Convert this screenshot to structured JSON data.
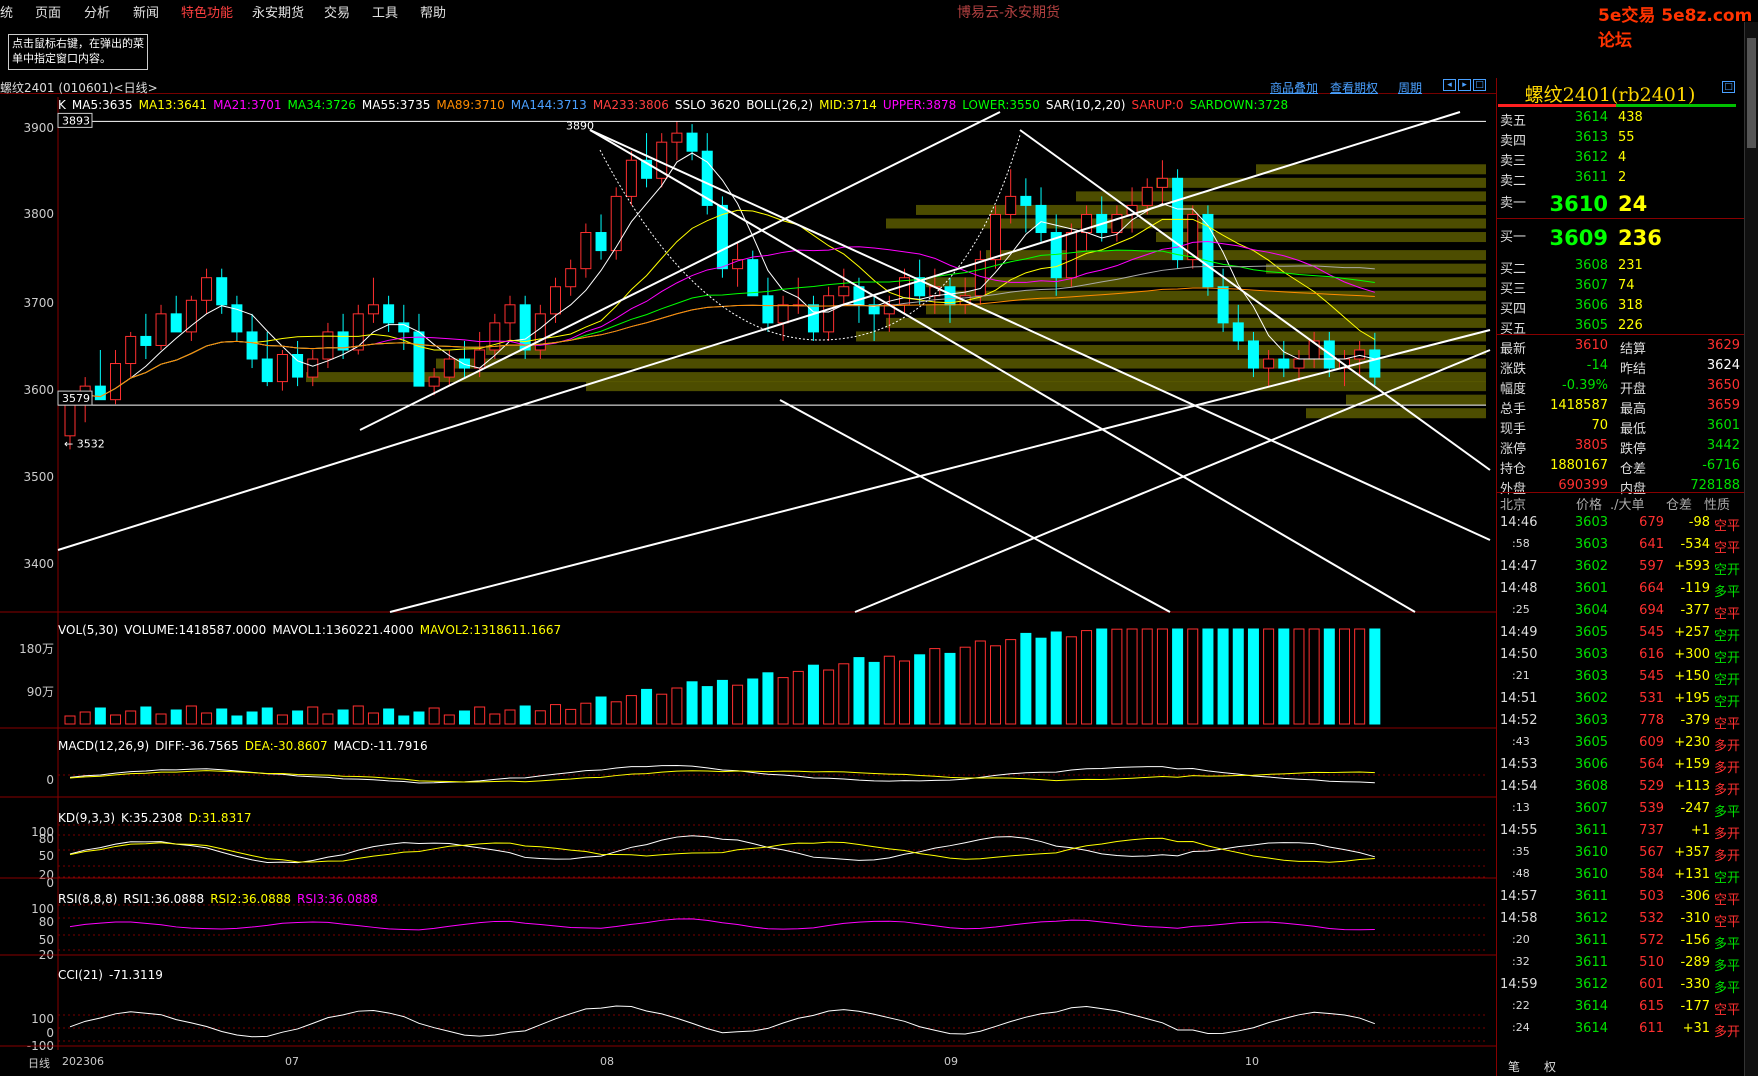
{
  "menu": [
    "统",
    "页面",
    "分析",
    "新闻",
    "特色功能",
    "永安期货",
    "交易",
    "工具",
    "帮助"
  ],
  "app_title": "博易云-永安期货",
  "watermark": "5e交易 5e8z.com 论坛",
  "tip": "点击鼠标右键，在弹出的菜单中指定窗口内容。",
  "symbol_label": "螺纹2401 (010601)<日线>",
  "header_links": [
    "商品叠加",
    "查看期权",
    "周期"
  ],
  "main_legend": [
    {
      "text": "K",
      "color": "#ffffff"
    },
    {
      "text": "MA5:3635",
      "color": "#ffffff"
    },
    {
      "text": "MA13:3641",
      "color": "#ffff00"
    },
    {
      "text": "MA21:3701",
      "color": "#ff00ff"
    },
    {
      "text": "MA34:3726",
      "color": "#00ff00"
    },
    {
      "text": "MA55:3735",
      "color": "#ffffff"
    },
    {
      "text": "MA89:3710",
      "color": "#ff8c00"
    },
    {
      "text": "MA144:3713",
      "color": "#4aa0ff"
    },
    {
      "text": "MA233:3806",
      "color": "#ff4040"
    },
    {
      "text": "SSLO 3620",
      "color": "#ffffff"
    },
    {
      "text": "BOLL(26,2)",
      "color": "#ffffff"
    },
    {
      "text": "MID:3714",
      "color": "#ffff00"
    },
    {
      "text": "UPPER:3878",
      "color": "#ff00ff"
    },
    {
      "text": "LOWER:3550",
      "color": "#00ff00"
    },
    {
      "text": "SAR(10,2,20)",
      "color": "#ffffff"
    },
    {
      "text": "SARUP:0",
      "color": "#ff3030"
    },
    {
      "text": "SARDOWN:3728",
      "color": "#00ff00"
    }
  ],
  "price_axis": [
    "3900",
    "3800",
    "3700",
    "3600",
    "3500",
    "3400"
  ],
  "price_marks": {
    "high_box": "3893",
    "low_box": "3579",
    "peak": "3890",
    "low": "3532"
  },
  "vol_legend": [
    {
      "text": "VOL(5,30)",
      "color": "#ffffff"
    },
    {
      "text": "VOLUME:1418587.0000",
      "color": "#ffffff"
    },
    {
      "text": "MAVOL1:1360221.4000",
      "color": "#ffffff"
    },
    {
      "text": "MAVOL2:1318611.1667",
      "color": "#ffff00"
    }
  ],
  "vol_axis": [
    "180万",
    "90万"
  ],
  "macd_legend": [
    {
      "text": "MACD(12,26,9)",
      "color": "#ffffff"
    },
    {
      "text": "DIFF:-36.7565",
      "color": "#ffffff"
    },
    {
      "text": "DEA:-30.8607",
      "color": "#ffff00"
    },
    {
      "text": "MACD:-11.7916",
      "color": "#ffffff"
    }
  ],
  "macd_axis": [
    "0"
  ],
  "kd_legend": [
    {
      "text": "KD(9,3,3)",
      "color": "#ffffff"
    },
    {
      "text": "K:35.2308",
      "color": "#ffffff"
    },
    {
      "text": "D:31.8317",
      "color": "#ffff00"
    }
  ],
  "kd_axis": [
    "100",
    "80",
    "50",
    "20",
    "0"
  ],
  "rsi_legend": [
    {
      "text": "RSI(8,8,8)",
      "color": "#ffffff"
    },
    {
      "text": "RSI1:36.0888",
      "color": "#ffffff"
    },
    {
      "text": "RSI2:36.0888",
      "color": "#ffff00"
    },
    {
      "text": "RSI3:36.0888",
      "color": "#ff00ff"
    }
  ],
  "rsi_axis": [
    "100",
    "80",
    "50",
    "20"
  ],
  "cci_legend": [
    {
      "text": "CCI(21)",
      "color": "#ffffff"
    },
    {
      "text": "-71.3119",
      "color": "#ffffff"
    }
  ],
  "cci_axis": [
    "100",
    "0",
    "-100"
  ],
  "x_axis": [
    {
      "label": "日线"
    },
    {
      "label": "202306"
    },
    {
      "label": "07"
    },
    {
      "label": "08"
    },
    {
      "label": "09"
    },
    {
      "label": "10"
    }
  ],
  "quote": {
    "title": "螺纹2401(rb2401)",
    "asks": [
      {
        "label": "卖五",
        "price": "3614",
        "vol": "438"
      },
      {
        "label": "卖四",
        "price": "3613",
        "vol": "55"
      },
      {
        "label": "卖三",
        "price": "3612",
        "vol": "4"
      },
      {
        "label": "卖二",
        "price": "3611",
        "vol": "2"
      },
      {
        "label": "卖一",
        "price": "3610",
        "vol": "24"
      }
    ],
    "bids": [
      {
        "label": "买一",
        "price": "3609",
        "vol": "236"
      },
      {
        "label": "买二",
        "price": "3608",
        "vol": "231"
      },
      {
        "label": "买三",
        "price": "3607",
        "vol": "74"
      },
      {
        "label": "买四",
        "price": "3606",
        "vol": "318"
      },
      {
        "label": "买五",
        "price": "3605",
        "vol": "226"
      }
    ],
    "stats": [
      {
        "l1": "最新",
        "v1": "3610",
        "c1": "#ff3030",
        "l2": "结算",
        "v2": "3629",
        "c2": "#ff3030"
      },
      {
        "l1": "涨跌",
        "v1": "-14",
        "c1": "#00e000",
        "l2": "昨结",
        "v2": "3624",
        "c2": "#ffffff"
      },
      {
        "l1": "幅度",
        "v1": "-0.39%",
        "c1": "#00e000",
        "l2": "开盘",
        "v2": "3650",
        "c2": "#ff3030"
      },
      {
        "l1": "总手",
        "v1": "1418587",
        "c1": "#ffff00",
        "l2": "最高",
        "v2": "3659",
        "c2": "#ff3030"
      },
      {
        "l1": "现手",
        "v1": "70",
        "c1": "#ffff00",
        "l2": "最低",
        "v2": "3601",
        "c2": "#00e000"
      },
      {
        "l1": "涨停",
        "v1": "3805",
        "c1": "#ff3030",
        "l2": "跌停",
        "v2": "3442",
        "c2": "#00e000"
      },
      {
        "l1": "持仓",
        "v1": "1880167",
        "c1": "#ffff00",
        "l2": "仓差",
        "v2": "-6716",
        "c2": "#00e000"
      },
      {
        "l1": "外盘",
        "v1": "690399",
        "c1": "#ff3030",
        "l2": "内盘",
        "v2": "728188",
        "c2": "#00e000"
      }
    ],
    "tick_header": [
      "北京",
      "价格",
      "./大单",
      "仓差",
      "性质"
    ],
    "ticks": [
      {
        "t": "14:46",
        "p": "3603",
        "q": "679",
        "d": "-98",
        "n": "空平"
      },
      {
        "t": ":58",
        "p": "3603",
        "q": "641",
        "d": "-534",
        "n": "空平"
      },
      {
        "t": "14:47",
        "p": "3602",
        "q": "597",
        "d": "+593",
        "n": "空开"
      },
      {
        "t": "14:48",
        "p": "3601",
        "q": "664",
        "d": "-119",
        "n": "多平"
      },
      {
        "t": ":25",
        "p": "3604",
        "q": "694",
        "d": "-377",
        "n": "空平"
      },
      {
        "t": "14:49",
        "p": "3605",
        "q": "545",
        "d": "+257",
        "n": "空开"
      },
      {
        "t": "14:50",
        "p": "3603",
        "q": "616",
        "d": "+300",
        "n": "空开"
      },
      {
        "t": ":21",
        "p": "3603",
        "q": "545",
        "d": "+150",
        "n": "空开"
      },
      {
        "t": "14:51",
        "p": "3602",
        "q": "531",
        "d": "+195",
        "n": "空开"
      },
      {
        "t": "14:52",
        "p": "3603",
        "q": "778",
        "d": "-379",
        "n": "空平"
      },
      {
        "t": ":43",
        "p": "3605",
        "q": "609",
        "d": "+230",
        "n": "多开"
      },
      {
        "t": "14:53",
        "p": "3606",
        "q": "564",
        "d": "+159",
        "n": "多开"
      },
      {
        "t": "14:54",
        "p": "3608",
        "q": "529",
        "d": "+113",
        "n": "多开"
      },
      {
        "t": ":13",
        "p": "3607",
        "q": "539",
        "d": "-247",
        "n": "多平"
      },
      {
        "t": "14:55",
        "p": "3611",
        "q": "737",
        "d": "+1",
        "n": "多开"
      },
      {
        "t": ":35",
        "p": "3610",
        "q": "567",
        "d": "+357",
        "n": "多开"
      },
      {
        "t": ":48",
        "p": "3610",
        "q": "584",
        "d": "+131",
        "n": "空开"
      },
      {
        "t": "14:57",
        "p": "3611",
        "q": "503",
        "d": "-306",
        "n": "空平"
      },
      {
        "t": "14:58",
        "p": "3612",
        "q": "532",
        "d": "-310",
        "n": "空平"
      },
      {
        "t": ":20",
        "p": "3611",
        "q": "572",
        "d": "-156",
        "n": "多平"
      },
      {
        "t": ":32",
        "p": "3611",
        "q": "510",
        "d": "-289",
        "n": "多平"
      },
      {
        "t": "14:59",
        "p": "3612",
        "q": "601",
        "d": "-330",
        "n": "多平"
      },
      {
        "t": ":22",
        "p": "3614",
        "q": "615",
        "d": "-177",
        "n": "空平"
      },
      {
        "t": ":24",
        "p": "3614",
        "q": "611",
        "d": "+31",
        "n": "多开"
      }
    ],
    "bottom_tabs": [
      "笔",
      "权"
    ]
  },
  "chart_data": {
    "type": "candlestick",
    "symbol": "螺纹2401",
    "period": "日线",
    "ylim": [
      3350,
      3920
    ],
    "candles": [
      [
        3545,
        3590,
        3530,
        3580
      ],
      [
        3580,
        3610,
        3560,
        3600
      ],
      [
        3600,
        3640,
        3590,
        3585
      ],
      [
        3585,
        3640,
        3580,
        3625
      ],
      [
        3625,
        3660,
        3610,
        3655
      ],
      [
        3655,
        3680,
        3630,
        3645
      ],
      [
        3645,
        3690,
        3640,
        3680
      ],
      [
        3680,
        3700,
        3660,
        3660
      ],
      [
        3660,
        3700,
        3650,
        3695
      ],
      [
        3695,
        3730,
        3680,
        3720
      ],
      [
        3720,
        3730,
        3680,
        3690
      ],
      [
        3690,
        3700,
        3650,
        3660
      ],
      [
        3660,
        3680,
        3620,
        3630
      ],
      [
        3630,
        3660,
        3600,
        3605
      ],
      [
        3605,
        3640,
        3595,
        3635
      ],
      [
        3635,
        3650,
        3600,
        3610
      ],
      [
        3610,
        3640,
        3600,
        3630
      ],
      [
        3630,
        3670,
        3620,
        3660
      ],
      [
        3660,
        3680,
        3630,
        3640
      ],
      [
        3640,
        3690,
        3635,
        3680
      ],
      [
        3680,
        3720,
        3670,
        3690
      ],
      [
        3690,
        3700,
        3660,
        3670
      ],
      [
        3670,
        3690,
        3640,
        3660
      ],
      [
        3660,
        3680,
        3620,
        3600
      ],
      [
        3600,
        3620,
        3590,
        3610
      ],
      [
        3610,
        3640,
        3600,
        3630
      ],
      [
        3630,
        3650,
        3610,
        3620
      ],
      [
        3620,
        3660,
        3610,
        3640
      ],
      [
        3640,
        3680,
        3630,
        3670
      ],
      [
        3670,
        3700,
        3650,
        3690
      ],
      [
        3690,
        3700,
        3630,
        3640
      ],
      [
        3640,
        3690,
        3630,
        3680
      ],
      [
        3680,
        3720,
        3670,
        3710
      ],
      [
        3710,
        3740,
        3700,
        3730
      ],
      [
        3730,
        3780,
        3720,
        3770
      ],
      [
        3770,
        3790,
        3740,
        3750
      ],
      [
        3750,
        3820,
        3740,
        3810
      ],
      [
        3810,
        3860,
        3800,
        3850
      ],
      [
        3850,
        3880,
        3820,
        3830
      ],
      [
        3830,
        3880,
        3820,
        3870
      ],
      [
        3870,
        3893,
        3850,
        3880
      ],
      [
        3880,
        3890,
        3850,
        3860
      ],
      [
        3860,
        3880,
        3790,
        3800
      ],
      [
        3800,
        3810,
        3720,
        3730
      ],
      [
        3730,
        3760,
        3710,
        3740
      ],
      [
        3740,
        3750,
        3700,
        3700
      ],
      [
        3700,
        3720,
        3660,
        3670
      ],
      [
        3670,
        3700,
        3650,
        3690
      ],
      [
        3690,
        3720,
        3680,
        3690
      ],
      [
        3690,
        3700,
        3650,
        3660
      ],
      [
        3660,
        3710,
        3650,
        3700
      ],
      [
        3700,
        3730,
        3690,
        3710
      ],
      [
        3710,
        3720,
        3670,
        3690
      ],
      [
        3690,
        3700,
        3650,
        3680
      ],
      [
        3680,
        3700,
        3660,
        3690
      ],
      [
        3690,
        3730,
        3680,
        3720
      ],
      [
        3720,
        3740,
        3690,
        3700
      ],
      [
        3700,
        3730,
        3680,
        3710
      ],
      [
        3710,
        3720,
        3670,
        3690
      ],
      [
        3690,
        3720,
        3680,
        3700
      ],
      [
        3700,
        3750,
        3690,
        3740
      ],
      [
        3740,
        3800,
        3730,
        3790
      ],
      [
        3790,
        3840,
        3780,
        3810
      ],
      [
        3810,
        3830,
        3770,
        3800
      ],
      [
        3800,
        3820,
        3760,
        3770
      ],
      [
        3770,
        3790,
        3700,
        3720
      ],
      [
        3720,
        3780,
        3710,
        3770
      ],
      [
        3770,
        3800,
        3750,
        3790
      ],
      [
        3790,
        3810,
        3760,
        3770
      ],
      [
        3770,
        3800,
        3760,
        3790
      ],
      [
        3790,
        3820,
        3770,
        3800
      ],
      [
        3800,
        3830,
        3790,
        3820
      ],
      [
        3820,
        3850,
        3800,
        3830
      ],
      [
        3830,
        3840,
        3730,
        3740
      ],
      [
        3740,
        3800,
        3730,
        3790
      ],
      [
        3790,
        3800,
        3700,
        3710
      ],
      [
        3710,
        3730,
        3660,
        3670
      ],
      [
        3670,
        3690,
        3640,
        3650
      ],
      [
        3650,
        3660,
        3610,
        3620
      ],
      [
        3620,
        3640,
        3600,
        3630
      ],
      [
        3630,
        3650,
        3610,
        3620
      ],
      [
        3620,
        3640,
        3605,
        3630
      ],
      [
        3630,
        3660,
        3620,
        3650
      ],
      [
        3650,
        3660,
        3610,
        3620
      ],
      [
        3620,
        3640,
        3600,
        3630
      ],
      [
        3630,
        3650,
        3610,
        3640
      ],
      [
        3640,
        3659,
        3601,
        3610
      ]
    ],
    "volume_axis": [
      "180万",
      "90万"
    ],
    "macd": {
      "diff": -36.7565,
      "dea": -30.8607,
      "macd": -11.7916
    },
    "kd": {
      "k": 35.2308,
      "d": 31.8317
    },
    "rsi": {
      "rsi1": 36.0888,
      "rsi2": 36.0888,
      "rsi3": 36.0888
    },
    "cci": -71.3119
  }
}
